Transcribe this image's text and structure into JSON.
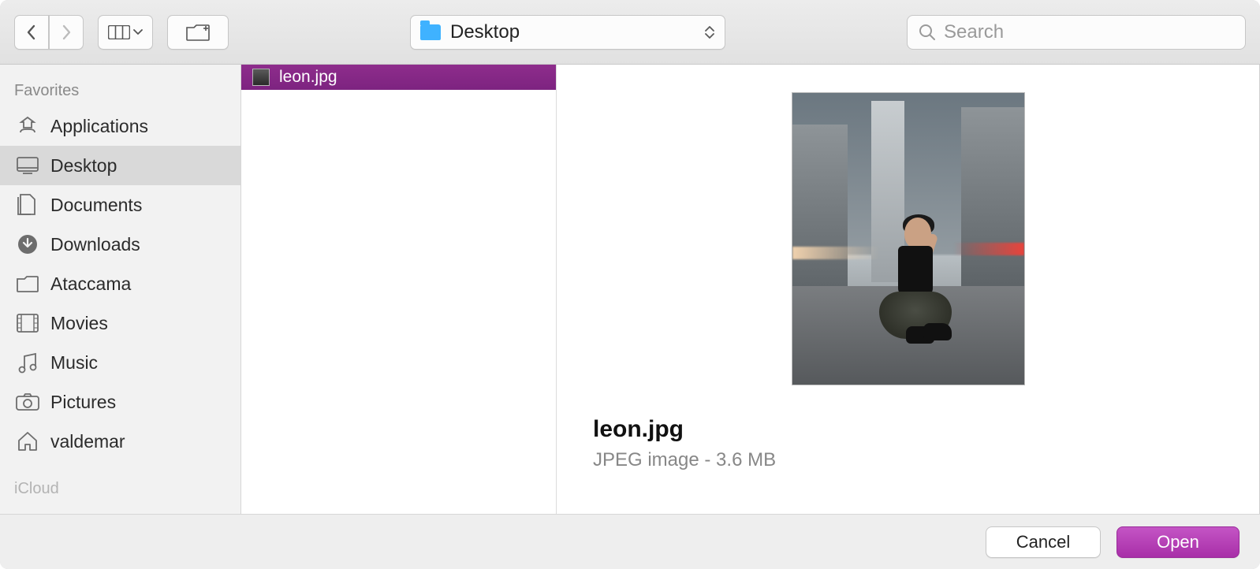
{
  "toolbar": {
    "location_label": "Desktop",
    "search_placeholder": "Search"
  },
  "sidebar": {
    "sections": [
      {
        "title": "Favorites"
      },
      {
        "title": "iCloud"
      }
    ],
    "favorites": [
      {
        "label": "Applications",
        "icon": "apps"
      },
      {
        "label": "Desktop",
        "icon": "desktop",
        "selected": true
      },
      {
        "label": "Documents",
        "icon": "documents"
      },
      {
        "label": "Downloads",
        "icon": "downloads"
      },
      {
        "label": "Ataccama",
        "icon": "folder"
      },
      {
        "label": "Movies",
        "icon": "movies"
      },
      {
        "label": "Music",
        "icon": "music"
      },
      {
        "label": "Pictures",
        "icon": "pictures"
      },
      {
        "label": "valdemar",
        "icon": "home"
      }
    ]
  },
  "file_list": [
    {
      "name": "leon.jpg",
      "selected": true
    }
  ],
  "preview": {
    "filename": "leon.jpg",
    "subtitle": "JPEG image - 3.6 MB"
  },
  "footer": {
    "cancel_label": "Cancel",
    "open_label": "Open"
  }
}
